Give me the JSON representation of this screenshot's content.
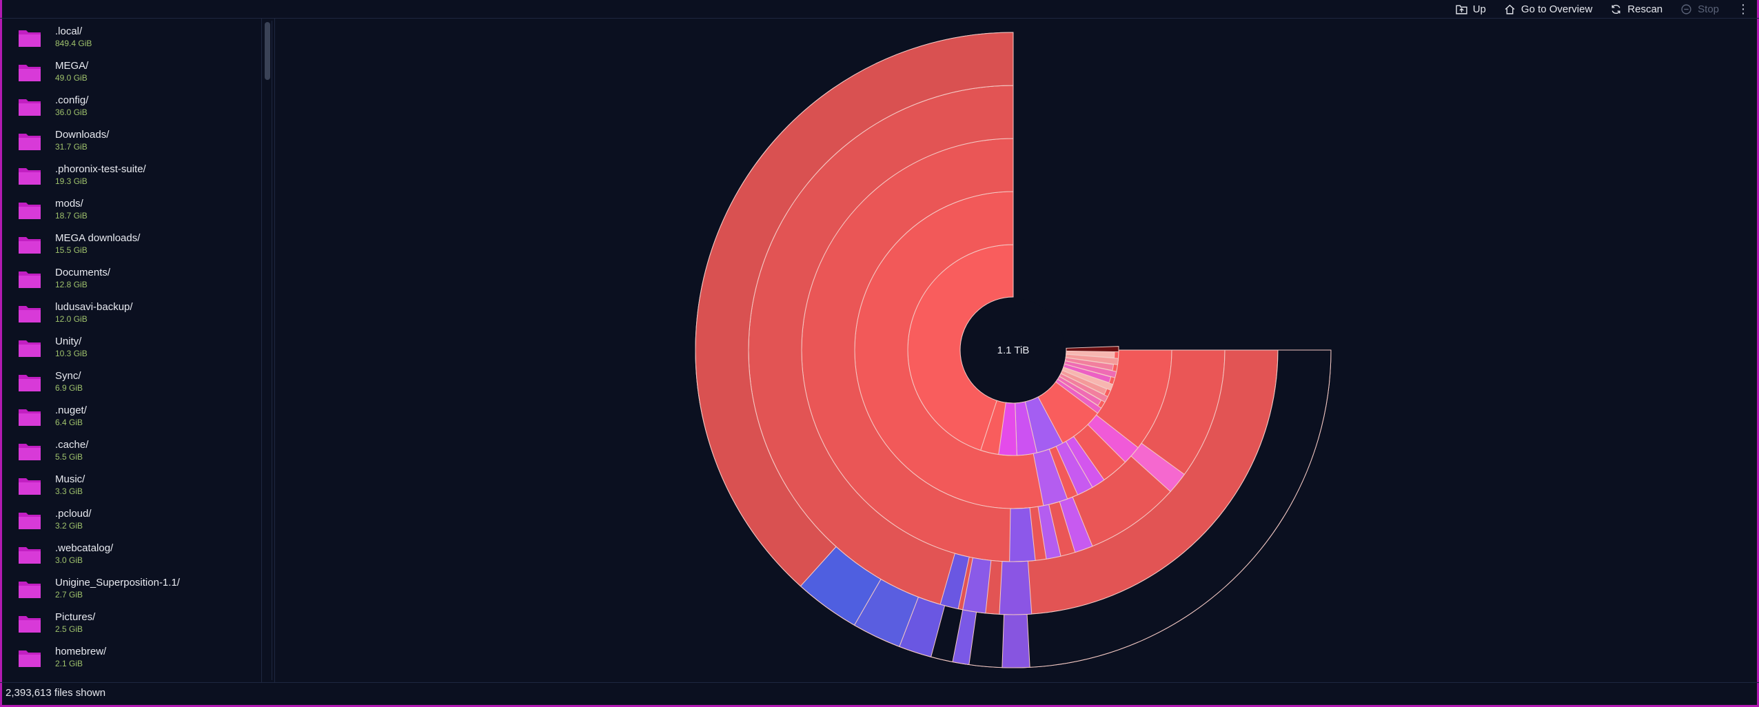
{
  "toolbar": {
    "up_label": "Up",
    "overview_label": "Go to Overview",
    "rescan_label": "Rescan",
    "stop_label": "Stop",
    "menu_icon": "kebab-menu-icon"
  },
  "sidebar": {
    "folders": [
      {
        "name": ".local/",
        "size": "849.4 GiB"
      },
      {
        "name": "MEGA/",
        "size": "49.0 GiB"
      },
      {
        "name": ".config/",
        "size": "36.0 GiB"
      },
      {
        "name": "Downloads/",
        "size": "31.7 GiB"
      },
      {
        "name": ".phoronix-test-suite/",
        "size": "19.3 GiB"
      },
      {
        "name": "mods/",
        "size": "18.7 GiB"
      },
      {
        "name": "MEGA downloads/",
        "size": "15.5 GiB"
      },
      {
        "name": "Documents/",
        "size": "12.8 GiB"
      },
      {
        "name": "ludusavi-backup/",
        "size": "12.0 GiB"
      },
      {
        "name": "Unity/",
        "size": "10.3 GiB"
      },
      {
        "name": "Sync/",
        "size": "6.9 GiB"
      },
      {
        "name": ".nuget/",
        "size": "6.4 GiB"
      },
      {
        "name": ".cache/",
        "size": "5.5 GiB"
      },
      {
        "name": "Music/",
        "size": "3.3 GiB"
      },
      {
        "name": ".pcloud/",
        "size": "3.2 GiB"
      },
      {
        "name": ".webcatalog/",
        "size": "3.0 GiB"
      },
      {
        "name": "Unigine_Superposition-1.1/",
        "size": "2.7 GiB"
      },
      {
        "name": "Pictures/",
        "size": "2.5 GiB"
      },
      {
        "name": "homebrew/",
        "size": "2.1 GiB"
      }
    ],
    "folder_icon": "folder-icon",
    "folder_color": "#c21fc2"
  },
  "chart": {
    "total_label": "1.1 TiB"
  },
  "status": {
    "files_shown": "2,393,613 files shown"
  },
  "colors": {
    "background": "#0b1020",
    "accent_border": "#b21ab2",
    "size_text": "#9fc26c"
  }
}
